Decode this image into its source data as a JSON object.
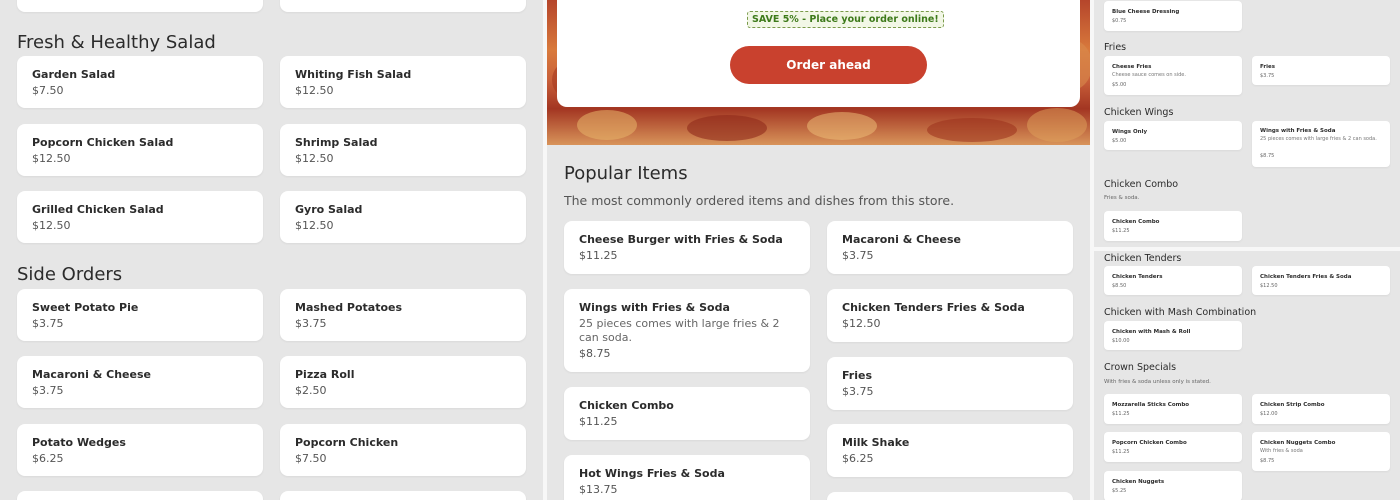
{
  "left": {
    "top_cards": [
      {
        "name": "",
        "price": ""
      },
      {
        "name": "",
        "price": ""
      }
    ],
    "sections": [
      {
        "title": "Fresh & Healthy Salad",
        "items": [
          {
            "name": "Garden Salad",
            "price": "$7.50"
          },
          {
            "name": "Whiting Fish Salad",
            "price": "$12.50"
          },
          {
            "name": "Popcorn Chicken Salad",
            "price": "$12.50"
          },
          {
            "name": "Shrimp Salad",
            "price": "$12.50"
          },
          {
            "name": "Grilled Chicken Salad",
            "price": "$12.50"
          },
          {
            "name": "Gyro Salad",
            "price": "$12.50"
          }
        ]
      },
      {
        "title": "Side Orders",
        "items": [
          {
            "name": "Sweet Potato Pie",
            "price": "$3.75"
          },
          {
            "name": "Mashed Potatoes",
            "price": "$3.75"
          },
          {
            "name": "Macaroni & Cheese",
            "price": "$3.75"
          },
          {
            "name": "Pizza Roll",
            "price": "$2.50"
          },
          {
            "name": "Potato Wedges",
            "price": "$6.25"
          },
          {
            "name": "Popcorn Chicken",
            "price": "$7.50"
          }
        ]
      }
    ]
  },
  "mid": {
    "save_text": "SAVE 5% - Place your order online!",
    "order_button": "Order ahead",
    "popular_title": "Popular Items",
    "popular_subtitle": "The most commonly ordered items and dishes from this store.",
    "col_left": [
      {
        "name": "Cheese Burger with Fries & Soda",
        "desc": "",
        "price": "$11.25"
      },
      {
        "name": "Wings with Fries & Soda",
        "desc": "25 pieces comes with large fries & 2 can soda.",
        "price": "$8.75"
      },
      {
        "name": "Chicken Combo",
        "desc": "",
        "price": "$11.25"
      },
      {
        "name": "Hot Wings Fries & Soda",
        "desc": "",
        "price": "$13.75"
      }
    ],
    "col_right": [
      {
        "name": "Macaroni & Cheese",
        "desc": "",
        "price": "$3.75"
      },
      {
        "name": "Chicken Tenders Fries & Soda",
        "desc": "",
        "price": "$12.50"
      },
      {
        "name": "Fries",
        "desc": "",
        "price": "$3.75"
      },
      {
        "name": "Milk Shake",
        "desc": "",
        "price": "$6.25"
      }
    ]
  },
  "right": {
    "top_item": {
      "name": "Blue Cheese Dressing",
      "price": "$0.75"
    },
    "fries": {
      "title": "Fries",
      "items": [
        {
          "name": "Cheese Fries",
          "desc": "Cheese sauce comes on side.",
          "price": "$5.00"
        },
        {
          "name": "Fries",
          "desc": "",
          "price": "$3.75"
        }
      ]
    },
    "wings": {
      "title": "Chicken Wings",
      "items": [
        {
          "name": "Wings Only",
          "desc": "",
          "price": "$5.00"
        },
        {
          "name": "Wings with Fries & Soda",
          "desc": "25 pieces comes with large fries & 2 can soda.",
          "price": "$8.75"
        }
      ]
    },
    "combo": {
      "title": "Chicken Combo",
      "subtitle": "Fries & soda.",
      "items": [
        {
          "name": "Chicken Combo",
          "desc": "",
          "price": "$11.25"
        }
      ]
    },
    "tenders": {
      "title": "Chicken Tenders",
      "items": [
        {
          "name": "Chicken Tenders",
          "desc": "",
          "price": "$8.50"
        },
        {
          "name": "Chicken Tenders Fries & Soda",
          "desc": "",
          "price": "$12.50"
        }
      ]
    },
    "mash": {
      "title": "Chicken with Mash Combination",
      "items": [
        {
          "name": "Chicken with Mash & Roll",
          "desc": "",
          "price": "$10.00"
        }
      ]
    },
    "crown": {
      "title": "Crown Specials",
      "subtitle": "With fries & soda unless only is stated.",
      "items": [
        {
          "name": "Mozzarella Sticks Combo",
          "desc": "",
          "price": "$11.25"
        },
        {
          "name": "Chicken Strip Combo",
          "desc": "",
          "price": "$12.00"
        },
        {
          "name": "Popcorn Chicken Combo",
          "desc": "",
          "price": "$11.25"
        },
        {
          "name": "Chicken Nuggets Combo",
          "desc": "With fries & soda",
          "price": "$8.75"
        },
        {
          "name": "Chicken Nuggets",
          "desc": "",
          "price": "$5.25"
        }
      ]
    }
  }
}
